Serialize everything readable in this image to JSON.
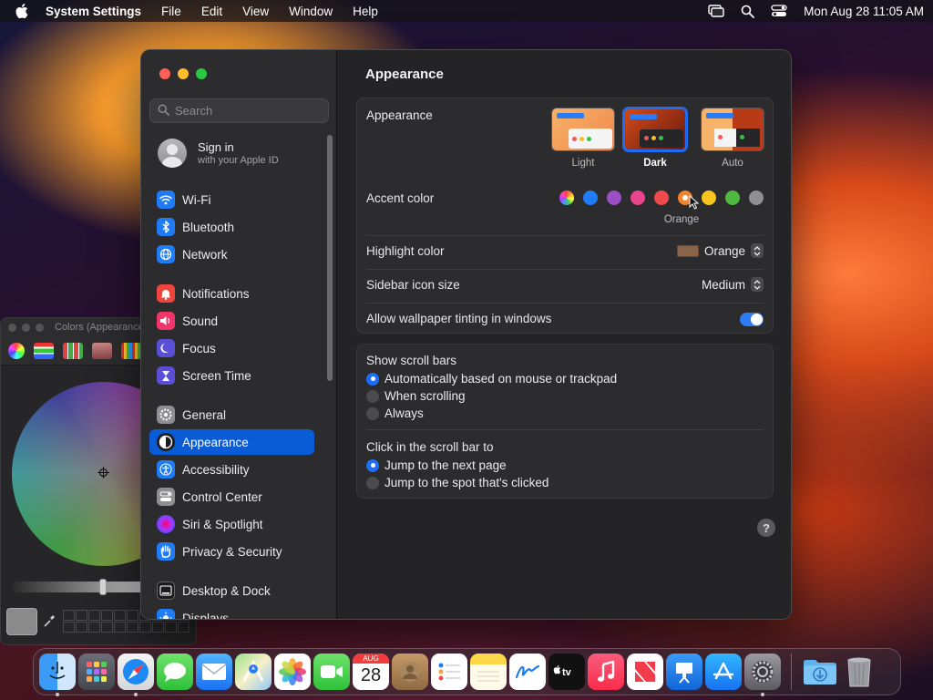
{
  "menubar": {
    "app_name": "System Settings",
    "menus": [
      "File",
      "Edit",
      "View",
      "Window",
      "Help"
    ],
    "clock": "Mon Aug 28  11:05 AM"
  },
  "colors_panel": {
    "title": "Colors (Appearance)"
  },
  "sidebar": {
    "search_placeholder": "Search",
    "sign_in": {
      "title": "Sign in",
      "subtitle": "with your Apple ID"
    },
    "groups": [
      [
        {
          "label": "Wi-Fi",
          "icon": "wifi-icon",
          "color": "#1f7cf6"
        },
        {
          "label": "Bluetooth",
          "icon": "bluetooth-icon",
          "color": "#1f7cf6"
        },
        {
          "label": "Network",
          "icon": "globe-icon",
          "color": "#1f7cf6"
        }
      ],
      [
        {
          "label": "Notifications",
          "icon": "bell-icon",
          "color": "#f0453c"
        },
        {
          "label": "Sound",
          "icon": "speaker-icon",
          "color": "#f0356b"
        },
        {
          "label": "Focus",
          "icon": "moon-icon",
          "color": "#5a4fd6"
        },
        {
          "label": "Screen Time",
          "icon": "hourglass-icon",
          "color": "#5a4fd6"
        }
      ],
      [
        {
          "label": "General",
          "icon": "gear-icon",
          "color": "#8e8e93"
        },
        {
          "label": "Appearance",
          "icon": "appearance-icon",
          "color": "#1c1c1e",
          "active": true
        },
        {
          "label": "Accessibility",
          "icon": "accessibility-icon",
          "color": "#1f7cf6"
        },
        {
          "label": "Control Center",
          "icon": "control-center-icon",
          "color": "#8e8e93"
        },
        {
          "label": "Siri & Spotlight",
          "icon": "siri-icon",
          "color": "#b038d8"
        },
        {
          "label": "Privacy & Security",
          "icon": "hand-icon",
          "color": "#1f7cf6"
        }
      ],
      [
        {
          "label": "Desktop & Dock",
          "icon": "dock-icon",
          "color": "#1c1c1e"
        },
        {
          "label": "Displays",
          "icon": "sun-icon",
          "color": "#1f7cf6"
        }
      ]
    ]
  },
  "content": {
    "title": "Appearance",
    "appearance": {
      "label": "Appearance",
      "options": [
        {
          "label": "Light",
          "selected": false
        },
        {
          "label": "Dark",
          "selected": true
        },
        {
          "label": "Auto",
          "selected": false
        }
      ]
    },
    "accent": {
      "label": "Accent color",
      "colors": [
        "multicolor",
        "#1f7cf6",
        "#9b4fc4",
        "#e9458f",
        "#ef4a4a",
        "#f4832e",
        "#f7c51e",
        "#4fb840",
        "#8e8e93"
      ],
      "selected_index": 5,
      "selected_name": "Orange"
    },
    "highlight": {
      "label": "Highlight color",
      "value": "Orange",
      "swatch": "#8a6448"
    },
    "sidebar_icon_size": {
      "label": "Sidebar icon size",
      "value": "Medium"
    },
    "wallpaper_tinting": {
      "label": "Allow wallpaper tinting in windows",
      "on": true
    },
    "scroll_bars": {
      "label": "Show scroll bars",
      "options": [
        {
          "label": "Automatically based on mouse or trackpad",
          "selected": true
        },
        {
          "label": "When scrolling",
          "selected": false
        },
        {
          "label": "Always",
          "selected": false
        }
      ]
    },
    "click_scroll": {
      "label": "Click in the scroll bar to",
      "options": [
        {
          "label": "Jump to the next page",
          "selected": true
        },
        {
          "label": "Jump to the spot that's clicked",
          "selected": false
        }
      ]
    },
    "help": "?"
  },
  "dock": {
    "calendar_month": "AUG",
    "calendar_day": "28"
  }
}
